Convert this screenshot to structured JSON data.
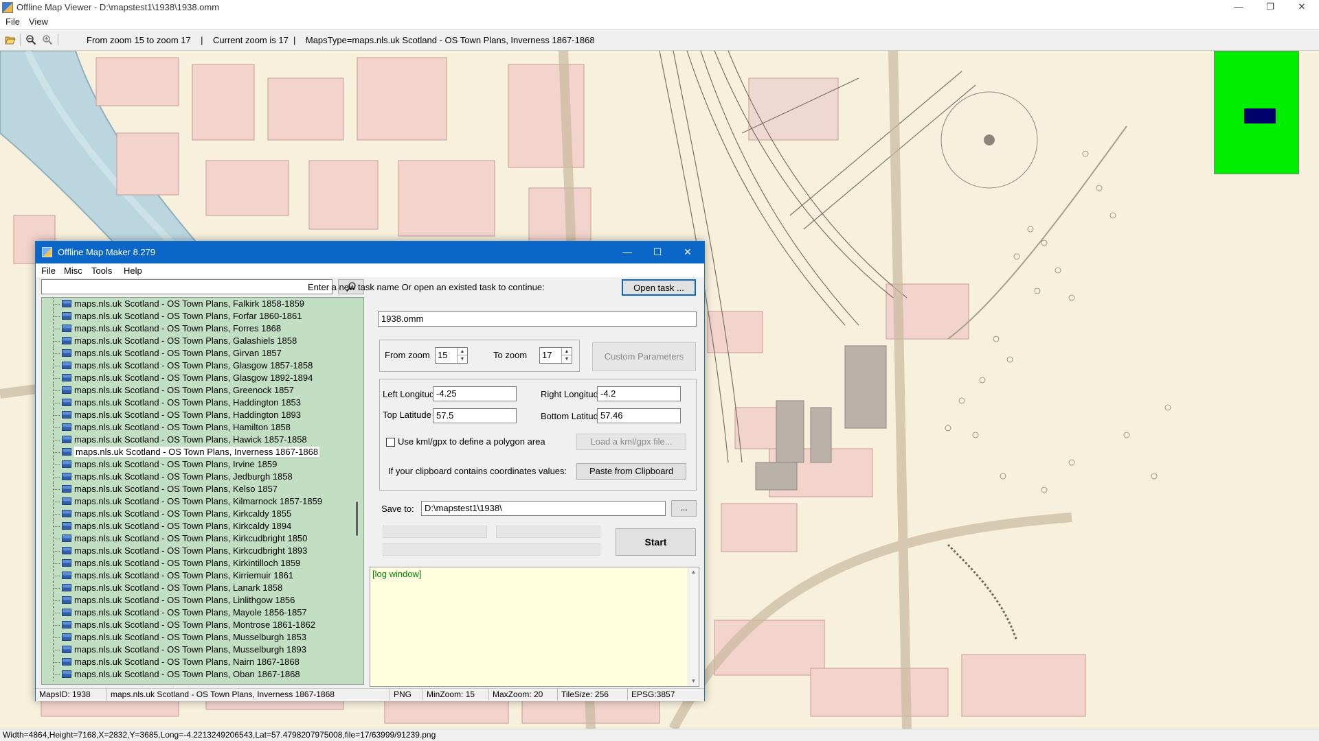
{
  "viewer": {
    "title": "Offline Map Viewer - D:\\mapstest1\\1938\\1938.omm",
    "menu": [
      "File",
      "View"
    ],
    "toolbar_info": "From zoom 15 to zoom 17    |    Current zoom is 17  |    MapsType=maps.nls.uk Scotland - OS Town Plans, Inverness 1867-1868",
    "status": "Width=4864,Height=7168,X=2832,Y=3685,Long=-4.2213249206543,Lat=57.4798207975008,file=17/63999/91239.png",
    "icons": [
      "open-folder-icon",
      "zoom-out-icon",
      "zoom-in-icon"
    ],
    "minimap_color": "#00ee00",
    "viewport_color": "#00006a"
  },
  "dialog": {
    "title": "Offline Map Maker 8.279",
    "menu": [
      "File",
      "Misc",
      "Tools",
      "Help"
    ],
    "search_placeholder": "",
    "task_prompt": "Enter a new task name Or open an existed task to continue:",
    "open_task_label": "Open task ...",
    "task_name": "1938.omm",
    "from_zoom_label": "From zoom",
    "from_zoom": "15",
    "to_zoom_label": "To zoom",
    "to_zoom": "17",
    "custom_params_label": "Custom Parameters",
    "left_long_label": "Left Longitude",
    "left_long": "-4.25",
    "right_long_label": "Right Longitude",
    "right_long": "-4.2",
    "top_lat_label": "Top Latitude",
    "top_lat": "57.5",
    "bottom_lat_label": "Bottom Latitude",
    "bottom_lat": "57.46",
    "kml_label": "Use kml/gpx to define a polygon area",
    "load_kml_label": "Load a kml/gpx file...",
    "clipboard_label": "If your clipboard contains coordinates values:",
    "paste_label": "Paste from Clipboard",
    "save_to_label": "Save to:",
    "save_to": "D:\\mapstest1\\1938\\",
    "browse_label": "...",
    "start_label": "Start",
    "log_text": "[log window]",
    "map_list": [
      "maps.nls.uk Scotland - OS Town Plans, Falkirk 1858-1859",
      "maps.nls.uk Scotland - OS Town Plans, Forfar 1860-1861",
      "maps.nls.uk Scotland - OS Town Plans, Forres 1868",
      "maps.nls.uk Scotland - OS Town Plans, Galashiels 1858",
      "maps.nls.uk Scotland - OS Town Plans, Girvan 1857",
      "maps.nls.uk Scotland - OS Town Plans, Glasgow 1857-1858",
      "maps.nls.uk Scotland - OS Town Plans, Glasgow 1892-1894",
      "maps.nls.uk Scotland - OS Town Plans, Greenock 1857",
      "maps.nls.uk Scotland - OS Town Plans, Haddington 1853",
      "maps.nls.uk Scotland - OS Town Plans, Haddington 1893",
      "maps.nls.uk Scotland - OS Town Plans, Hamilton 1858",
      "maps.nls.uk Scotland - OS Town Plans, Hawick 1857-1858",
      "maps.nls.uk Scotland - OS Town Plans, Inverness 1867-1868",
      "maps.nls.uk Scotland - OS Town Plans, Irvine 1859",
      "maps.nls.uk Scotland - OS Town Plans, Jedburgh 1858",
      "maps.nls.uk Scotland - OS Town Plans, Kelso 1857",
      "maps.nls.uk Scotland - OS Town Plans, Kilmarnock 1857-1859",
      "maps.nls.uk Scotland - OS Town Plans, Kirkcaldy 1855",
      "maps.nls.uk Scotland - OS Town Plans, Kirkcaldy 1894",
      "maps.nls.uk Scotland - OS Town Plans, Kirkcudbright 1850",
      "maps.nls.uk Scotland - OS Town Plans, Kirkcudbright 1893",
      "maps.nls.uk Scotland - OS Town Plans, Kirkintilloch 1859",
      "maps.nls.uk Scotland - OS Town Plans, Kirriemuir 1861",
      "maps.nls.uk Scotland - OS Town Plans, Lanark 1858",
      "maps.nls.uk Scotland - OS Town Plans, Linlithgow 1856",
      "maps.nls.uk Scotland - OS Town Plans, Mayole 1856-1857",
      "maps.nls.uk Scotland - OS Town Plans, Montrose 1861-1862",
      "maps.nls.uk Scotland - OS Town Plans, Musselburgh 1853",
      "maps.nls.uk Scotland - OS Town Plans, Musselburgh 1893",
      "maps.nls.uk Scotland - OS Town Plans, Nairn 1867-1868",
      "maps.nls.uk Scotland - OS Town Plans, Oban 1867-1868"
    ],
    "selected_index": 12,
    "status": {
      "maps_id": "MapsID: 1938",
      "name": "maps.nls.uk Scotland - OS Town Plans, Inverness 1867-1868",
      "format": "PNG",
      "min_zoom": "MinZoom: 15",
      "max_zoom": "MaxZoom: 20",
      "tile_size": "TileSize: 256",
      "epsg": "EPSG:3857"
    }
  }
}
